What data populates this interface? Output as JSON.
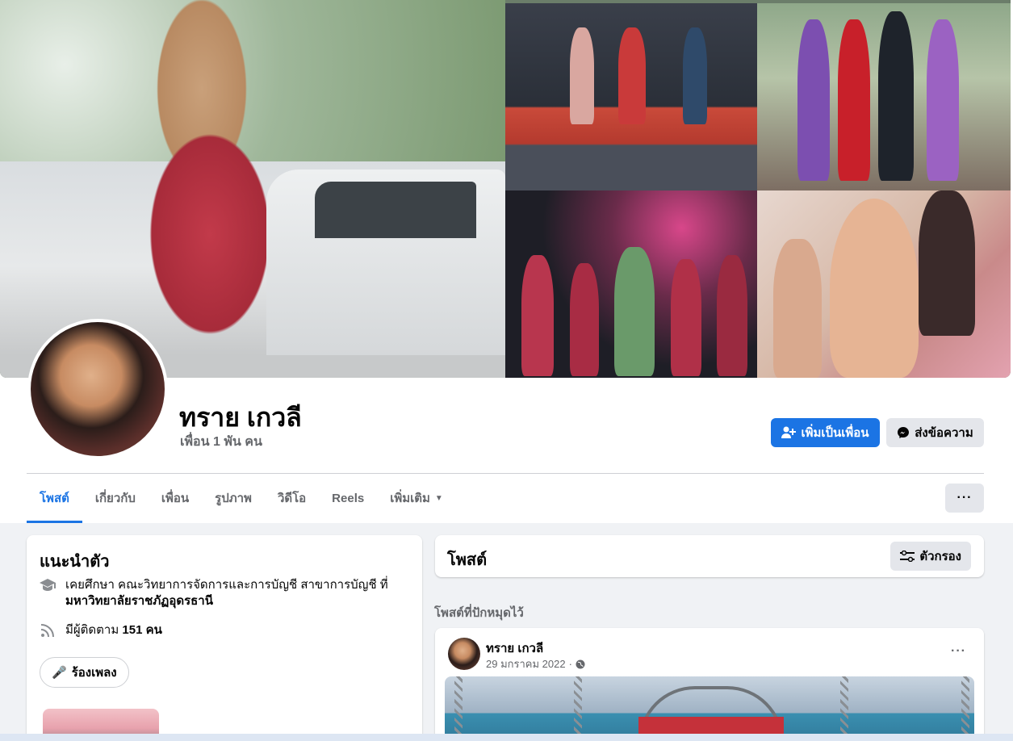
{
  "profile": {
    "name": "ทราย เกวลี",
    "friends": "เพื่อน 1 พัน คน"
  },
  "actions": {
    "add_friend": "เพิ่มเป็นเพื่อน",
    "message": "ส่งข้อความ",
    "more": "···"
  },
  "tabs": [
    {
      "label": "โพสต์"
    },
    {
      "label": "เกี่ยวกับ"
    },
    {
      "label": "เพื่อน"
    },
    {
      "label": "รูปภาพ"
    },
    {
      "label": "วิดีโอ"
    },
    {
      "label": "Reels"
    },
    {
      "label": "เพิ่มเติม"
    }
  ],
  "intro": {
    "title": "แนะนำตัว",
    "education_prefix": "เคยศึกษา คณะวิทยาการจัดการและการบัญชี สาขาการบัญชี ที่",
    "education_school": "มหาวิทยาลัยราชภัฏอุดรธานี",
    "followers_prefix": "มีผู้ติดตาม",
    "followers_count": "151 คน",
    "hobby": "ร้องเพลง"
  },
  "posts": {
    "title": "โพสต์",
    "filter": "ตัวกรอง",
    "pinned_label": "โพสต์ที่ปักหมุดไว้",
    "pinned": {
      "author": "ทราย เกวลี",
      "date": "29 มกราคม 2022",
      "more": "···"
    }
  },
  "colors": {
    "accent": "#1b74e4",
    "secondary_button": "#e4e6eb",
    "muted_text": "#65676b",
    "background": "#f0f2f5"
  }
}
